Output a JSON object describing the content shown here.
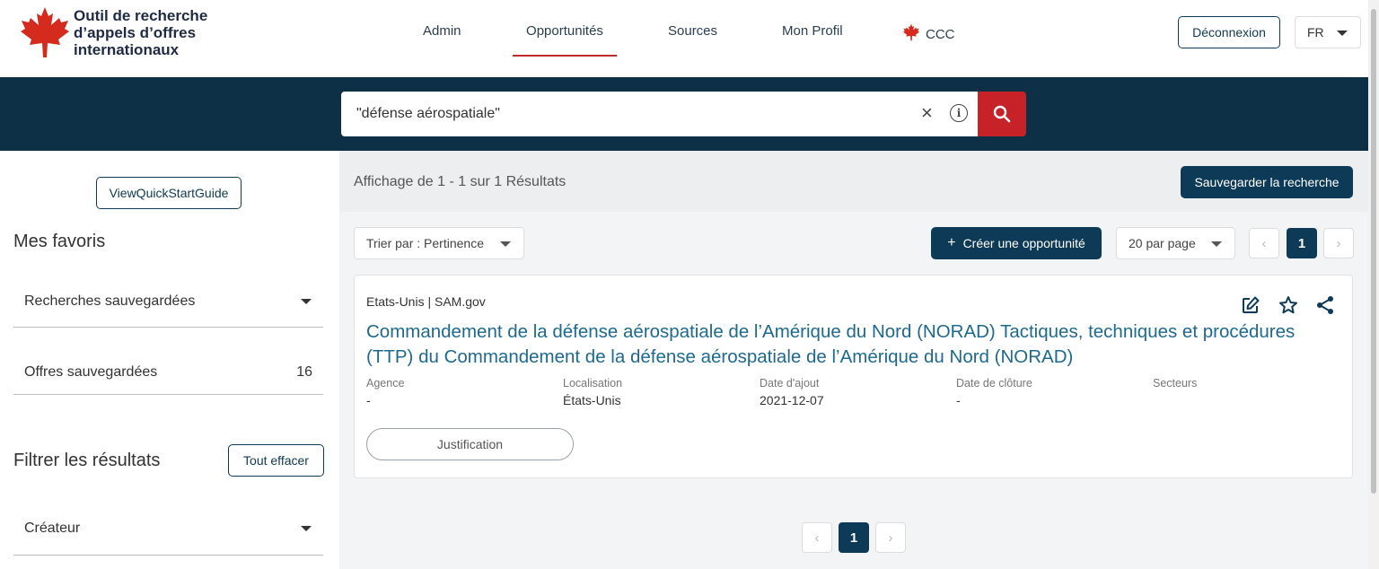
{
  "header": {
    "logo_text": "Outil de recherche d’appels d’offres internationaux",
    "nav": [
      "Admin",
      "Opportunités",
      "Sources",
      "Mon Profil",
      "CCC"
    ],
    "active_nav": "Opportunités",
    "logout_label": "Déconnexion",
    "language": "FR"
  },
  "search": {
    "value": "\"défense aérospatiale\"",
    "clear_icon": "×",
    "info_icon": "i"
  },
  "sidebar": {
    "quickstart_label": "ViewQuickStartGuide",
    "favorites_heading": "Mes favoris",
    "saved_searches_label": "Recherches sauvegardées",
    "saved_offers_label": "Offres sauvegardées",
    "saved_offers_count": "16",
    "filter_heading": "Filtrer les résultats",
    "clear_all_label": "Tout effacer",
    "creator_label": "Créateur"
  },
  "results": {
    "summary": "Affichage de 1 - 1 sur 1 Résultats",
    "save_search_label": "Sauvegarder la recherche",
    "sort_label": "Trier par : Pertinence",
    "create_label": "Créer une opportunité",
    "create_plus": "+",
    "per_page_label": "20 par page",
    "current_page": "1",
    "prev_symbol": "‹",
    "next_symbol": "›"
  },
  "card": {
    "source": "Etats-Unis | SAM.gov",
    "title": "Commandement de la défense aérospatiale de l’Amérique du Nord (NORAD) Tactiques, techniques et procédures (TTP) du Commandement de la défense aérospatiale de l’Amérique du Nord (NORAD)",
    "meta": [
      {
        "label": "Agence",
        "value": "-"
      },
      {
        "label": "Localisation",
        "value": "États-Unis"
      },
      {
        "label": "Date d'ajout",
        "value": "2021-12-07"
      },
      {
        "label": "Date de clôture",
        "value": "-"
      },
      {
        "label": "Secteurs",
        "value": ""
      }
    ],
    "justification_label": "Justification"
  },
  "colors": {
    "navy": "#0d3047",
    "button_navy": "#0d3a57",
    "accent_red": "#c62227",
    "link_blue": "#1e6a8f"
  },
  "icons": [
    "maple-leaf-icon",
    "chevron-down-icon",
    "close-icon",
    "info-icon",
    "search-icon",
    "edit-icon",
    "star-icon",
    "share-icon",
    "chevron-left-icon",
    "chevron-right-icon"
  ]
}
